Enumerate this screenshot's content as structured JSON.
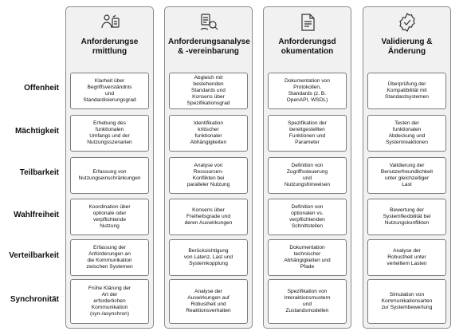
{
  "columns": [
    {
      "title": "Anforderungse\nrmittlung",
      "icon": "requirements-checklist-icon",
      "cells": [
        "Klarheit über\nBegriffsverständnis\nund\nStandardisierungsgrad",
        "Erhebung des\nfunktionalen\nUmfangs und der\nNutzungsszenarien",
        "Erfassung von\nNutzungseinschränkungen",
        "Koordination über\noptionale oder\nverpflichtende\nNutzung",
        "Erfassung der\nAnforderungen an\ndie Kommunikation\nzwischen Systemen",
        "Frühe Klärung der\nArt der\nerforderlichen\nKommunikation\n(syn-/asynchron)"
      ]
    },
    {
      "title": "Anforderungsanalyse\n& -vereinbarung",
      "icon": "analysis-agreement-icon",
      "cells": [
        "Abgleich mit\nbestehenden\nStandards und\nKonsens über\nSpezifikationsgrad",
        "Identifikation\nkritischer\nfunktionaler\nAbhängigkeiten",
        "Analyse von\nRessourcen-\nKonflikten bei\nparalleler Nutzung",
        "Konsens über\nFreiheitsgrade und\nderen Auswirkungen",
        "Berücksichtigung\nvon Latenz, Last und\nSystemkopplung",
        "Analyse der\nAuswirkungen auf\nRobustheit und\nReaktionsverhalten"
      ]
    },
    {
      "title": "Anforderungsd\nokumentation",
      "icon": "document-icon",
      "cells": [
        "Dokumentation von\nProtokollen,\nStandards (z. B.\nOpenAPI, WSDL)",
        "Spezifikation der\nbereitgestellten\nFunktionen und\nParameter",
        "Definition von\nZugriffssteuerung\nund\nNutzungshinweisen",
        "Definition von\noptionalen vs.\nverpflichtenden\nSchnittstellen",
        "Dokumentation\ntechnischer\nAbhängigkeiten und\nPfade",
        "Spezifikation von\nInteraktionsmustern\nund\nZustandsmodellen"
      ]
    },
    {
      "title": "Validierung &\nÄnderung",
      "icon": "validation-check-icon",
      "cells": [
        "Überprüfung der\nKompatibilität mit\nStandardsystemen",
        "Testen der\nfunktionalen\nAbdeckung und\nSystemreaktionen",
        "Validierung der\nBenutzerfreundlichkeit\nunter gleichzeitiger\nLast",
        "Bewertung der\nSystemflexibilität bei\nNutzungskonflikten",
        "Analyse der\nRobustheit unter\nverteiltem Lasten",
        "Simulation von\nKommunikationsarten\nzur Systembewertung"
      ]
    }
  ],
  "rows": [
    "Offenheit",
    "Mächtigkeit",
    "Teilbarkeit",
    "Wahlfreiheit",
    "Verteilbarkeit",
    "Synchronität"
  ]
}
